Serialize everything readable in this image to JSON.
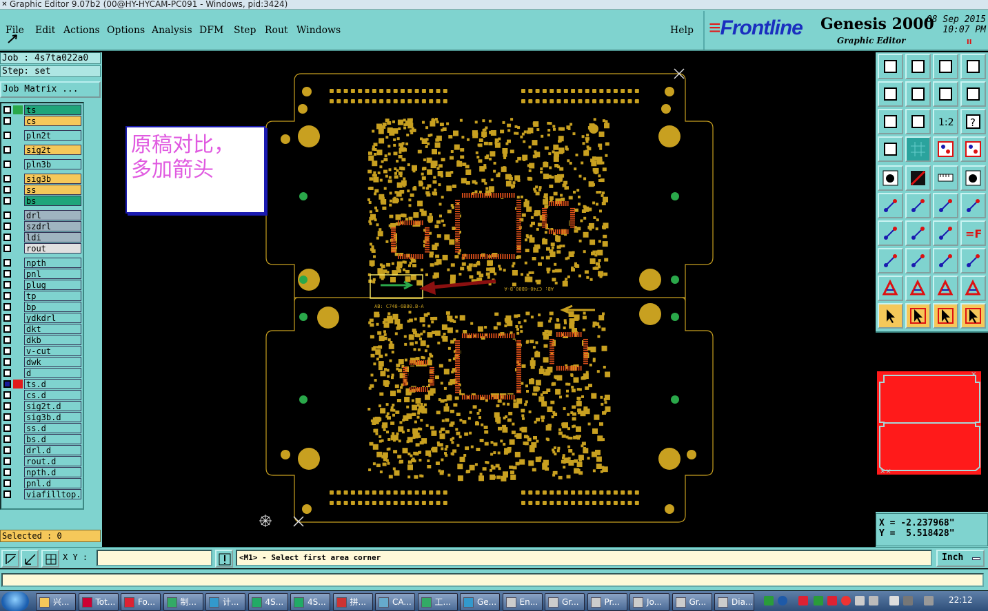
{
  "window": {
    "title": "Graphic Editor 9.07b2 (00@HY-HYCAM-PC091 - Windows, pid:3424)"
  },
  "menu": [
    "File",
    "Edit",
    "Actions",
    "Options",
    "Analysis",
    "DFM",
    "Step",
    "Rout",
    "Windows"
  ],
  "help_label": "Help",
  "logo": {
    "brand": "Frontline",
    "product": "Genesis 2000",
    "subtitle": "Graphic Editor",
    "date": "08 Sep 2015",
    "time": "10:07 PM",
    "pause": "II"
  },
  "job": {
    "job_line": "Job : 4s7ta022a0",
    "step_line": "Step: set",
    "matrix_button": "Job Matrix ..."
  },
  "layers": [
    {
      "name": "ts",
      "color": "#1fa57a",
      "swatch": "#2aa84a",
      "checked": false
    },
    {
      "name": "cs",
      "color": "#f5c85a",
      "swatch": "",
      "checked": false
    },
    {
      "name": "pln2t",
      "color": "#7fd3cf",
      "swatch": "",
      "checked": false
    },
    {
      "name": "sig2t",
      "color": "#f5c85a",
      "swatch": "",
      "checked": false
    },
    {
      "name": "pln3b",
      "color": "#7fd3cf",
      "swatch": "",
      "checked": false
    },
    {
      "name": "sig3b",
      "color": "#f5c85a",
      "swatch": "",
      "checked": false
    },
    {
      "name": "ss",
      "color": "#f5c85a",
      "swatch": "",
      "checked": false
    },
    {
      "name": "bs",
      "color": "#1fa57a",
      "swatch": "",
      "checked": false
    },
    {
      "name": "drl",
      "color": "#9fb4c0",
      "swatch": "",
      "checked": false
    },
    {
      "name": "szdrl",
      "color": "#9fb4c0",
      "swatch": "",
      "checked": false
    },
    {
      "name": "ldi",
      "color": "#9fb4c0",
      "swatch": "",
      "checked": false
    },
    {
      "name": "rout",
      "color": "#e0e0e0",
      "swatch": "",
      "checked": false
    },
    {
      "name": "npth",
      "color": "#7fd3cf",
      "swatch": "",
      "checked": false
    },
    {
      "name": "pnl",
      "color": "#7fd3cf",
      "swatch": "",
      "checked": false
    },
    {
      "name": "plug",
      "color": "#7fd3cf",
      "swatch": "",
      "checked": false
    },
    {
      "name": "tp",
      "color": "#7fd3cf",
      "swatch": "",
      "checked": false
    },
    {
      "name": "bp",
      "color": "#7fd3cf",
      "swatch": "",
      "checked": false
    },
    {
      "name": "ydkdrl",
      "color": "#7fd3cf",
      "swatch": "",
      "checked": false
    },
    {
      "name": "dkt",
      "color": "#7fd3cf",
      "swatch": "",
      "checked": false
    },
    {
      "name": "dkb",
      "color": "#7fd3cf",
      "swatch": "",
      "checked": false
    },
    {
      "name": "v-cut",
      "color": "#7fd3cf",
      "swatch": "",
      "checked": false
    },
    {
      "name": "dwk",
      "color": "#7fd3cf",
      "swatch": "",
      "checked": false
    },
    {
      "name": "d",
      "color": "#7fd3cf",
      "swatch": "",
      "checked": false
    },
    {
      "name": "ts.d",
      "color": "#7fd3cf",
      "swatch": "#e21b1b",
      "checked": true
    },
    {
      "name": "cs.d",
      "color": "#7fd3cf",
      "swatch": "",
      "checked": false
    },
    {
      "name": "sig2t.d",
      "color": "#7fd3cf",
      "swatch": "",
      "checked": false
    },
    {
      "name": "sig3b.d",
      "color": "#7fd3cf",
      "swatch": "",
      "checked": false
    },
    {
      "name": "ss.d",
      "color": "#7fd3cf",
      "swatch": "",
      "checked": false
    },
    {
      "name": "bs.d",
      "color": "#7fd3cf",
      "swatch": "",
      "checked": false
    },
    {
      "name": "drl.d",
      "color": "#7fd3cf",
      "swatch": "",
      "checked": false
    },
    {
      "name": "rout.d",
      "color": "#7fd3cf",
      "swatch": "",
      "checked": false
    },
    {
      "name": "npth.d",
      "color": "#7fd3cf",
      "swatch": "",
      "checked": false
    },
    {
      "name": "pnl.d",
      "color": "#7fd3cf",
      "swatch": "",
      "checked": false
    },
    {
      "name": "viafilltop.d",
      "color": "#7fd3cf",
      "swatch": "",
      "checked": false
    }
  ],
  "selected": "Selected : 0",
  "note": "原稿对比，\n多加箭头",
  "board_text": {
    "top_label": "AB: C748-6B80.B-A",
    "bottom_label": "AB: C748-6B80.B-A"
  },
  "coords": {
    "x": "X = -2.237968\"",
    "y": "Y =  5.518428\""
  },
  "cmd": {
    "xy_label": "X Y :",
    "xy_value": "",
    "prompt": "<M1> - Select first area corner",
    "unit": "Inch"
  },
  "taskbar": {
    "tasks": [
      "兴...",
      "Tot...",
      "Fo...",
      "制...",
      "计...",
      "4S...",
      "4S...",
      "拼...",
      "CA...",
      "工...",
      "Ge...",
      "En...",
      "Gr...",
      "Pr...",
      "Jo...",
      "Gr...",
      "Dia..."
    ],
    "clock": "22:12"
  },
  "colors": {
    "panel": "#7fd3cf",
    "copper": "#c8a020",
    "pad_red": "#e0501a",
    "outline": "#c8a020",
    "arrow_green": "#2aa84a",
    "arrow_red": "#8b1010"
  }
}
